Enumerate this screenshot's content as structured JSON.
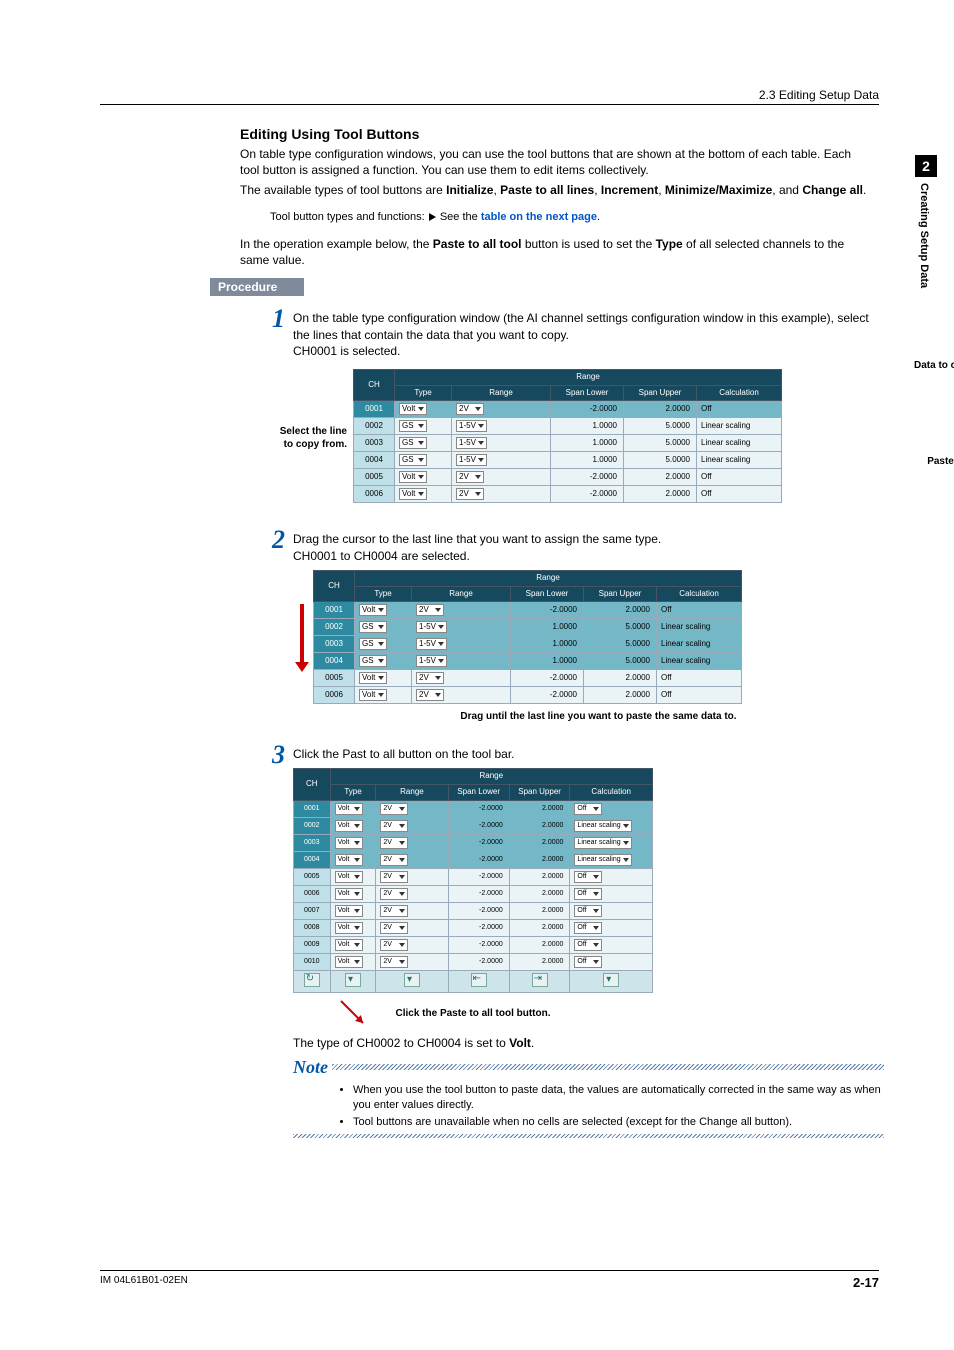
{
  "header": {
    "breadcrumb": "2.3  Editing Setup Data"
  },
  "side": {
    "chapter": "2",
    "chapter_title": "Creating Setup Data"
  },
  "title": "Editing Using Tool Buttons",
  "p1a": "On table type configuration windows, you can use the tool buttons that are shown at the bottom of each table. Each tool button is assigned a function. You can use them to edit items collectively.",
  "p1b_pre": "The available types of tool buttons are ",
  "p1b_b1": "Initialize",
  "p1b_mid1": ", ",
  "p1b_b2": "Paste to all lines",
  "p1b_mid2": ", ",
  "p1b_b3": "Increment",
  "p1b_mid3": ", ",
  "p1b_b4": "Minimize/Maximize",
  "p1b_mid4": ", and ",
  "p1b_b5": "Change all",
  "p1b_end": ".",
  "p1c_pre": "Tool button types and functions: ",
  "p1c_link_pre": "See the ",
  "p1c_link": "table on the next page",
  "p2_pre": "In the operation example below, the ",
  "p2_b1": "Paste to all tool",
  "p2_mid": " button is used to set the ",
  "p2_b2": "Type",
  "p2_end": " of all selected channels to the same value.",
  "procedure_label": "Procedure",
  "steps": {
    "1": {
      "num": "1",
      "text_a": "On the table type configuration window (the AI channel settings configuration window in this example), select the lines that contain the data that you want to copy.",
      "text_b": "CH0001 is selected."
    },
    "2": {
      "num": "2",
      "text_a": "Drag the cursor to the last line that you want to assign the same type.",
      "text_b": "CH0001 to CH0004 are selected."
    },
    "3": {
      "num": "3",
      "text_pre": "Click the ",
      "text_b": "Past to all",
      "text_post": " button on the tool bar."
    }
  },
  "callouts": {
    "data_to_copy": "Data to copy",
    "select_line_a": "Select the line",
    "select_line_b": "to copy from.",
    "paste_dest": "Paste destination",
    "drag_caption": "Drag until the last line you want to paste the same data to.",
    "click_caption": "Click the Paste to all tool button."
  },
  "headers": {
    "ch": "CH",
    "range_group": "Range",
    "type": "Type",
    "range": "Range",
    "span_lower": "Span Lower",
    "span_upper": "Span Upper",
    "calculation": "Calculation"
  },
  "table1": [
    {
      "ch": "0001",
      "type": "Volt",
      "range": "2V",
      "lo": "-2.0000",
      "up": "2.0000",
      "calc": "Off",
      "sel": true
    },
    {
      "ch": "0002",
      "type": "GS",
      "range": "1-5V",
      "lo": "1.0000",
      "up": "5.0000",
      "calc": "Linear scaling",
      "sel": false
    },
    {
      "ch": "0003",
      "type": "GS",
      "range": "1-5V",
      "lo": "1.0000",
      "up": "5.0000",
      "calc": "Linear scaling",
      "sel": false
    },
    {
      "ch": "0004",
      "type": "GS",
      "range": "1-5V",
      "lo": "1.0000",
      "up": "5.0000",
      "calc": "Linear scaling",
      "sel": false
    },
    {
      "ch": "0005",
      "type": "Volt",
      "range": "2V",
      "lo": "-2.0000",
      "up": "2.0000",
      "calc": "Off",
      "sel": false
    },
    {
      "ch": "0006",
      "type": "Volt",
      "range": "2V",
      "lo": "-2.0000",
      "up": "2.0000",
      "calc": "Off",
      "sel": false
    }
  ],
  "table2": [
    {
      "ch": "0001",
      "type": "Volt",
      "range": "2V",
      "lo": "-2.0000",
      "up": "2.0000",
      "calc": "Off",
      "sel": true
    },
    {
      "ch": "0002",
      "type": "GS",
      "range": "1-5V",
      "lo": "1.0000",
      "up": "5.0000",
      "calc": "Linear scaling",
      "sel": true
    },
    {
      "ch": "0003",
      "type": "GS",
      "range": "1-5V",
      "lo": "1.0000",
      "up": "5.0000",
      "calc": "Linear scaling",
      "sel": true
    },
    {
      "ch": "0004",
      "type": "GS",
      "range": "1-5V",
      "lo": "1.0000",
      "up": "5.0000",
      "calc": "Linear scaling",
      "sel": true
    },
    {
      "ch": "0005",
      "type": "Volt",
      "range": "2V",
      "lo": "-2.0000",
      "up": "2.0000",
      "calc": "Off",
      "sel": false
    },
    {
      "ch": "0006",
      "type": "Volt",
      "range": "2V",
      "lo": "-2.0000",
      "up": "2.0000",
      "calc": "Off",
      "sel": false
    }
  ],
  "table3": [
    {
      "ch": "0001",
      "type": "Volt",
      "range": "2V",
      "lo": "-2.0000",
      "up": "2.0000",
      "calc": "Off",
      "sel": true
    },
    {
      "ch": "0002",
      "type": "Volt",
      "range": "2V",
      "lo": "-2.0000",
      "up": "2.0000",
      "calc": "Linear scaling",
      "sel": true
    },
    {
      "ch": "0003",
      "type": "Volt",
      "range": "2V",
      "lo": "-2.0000",
      "up": "2.0000",
      "calc": "Linear scaling",
      "sel": true
    },
    {
      "ch": "0004",
      "type": "Volt",
      "range": "2V",
      "lo": "-2.0000",
      "up": "2.0000",
      "calc": "Linear scaling",
      "sel": true
    },
    {
      "ch": "0005",
      "type": "Volt",
      "range": "2V",
      "lo": "-2.0000",
      "up": "2.0000",
      "calc": "Off",
      "sel": false
    },
    {
      "ch": "0006",
      "type": "Volt",
      "range": "2V",
      "lo": "-2.0000",
      "up": "2.0000",
      "calc": "Off",
      "sel": false
    },
    {
      "ch": "0007",
      "type": "Volt",
      "range": "2V",
      "lo": "-2.0000",
      "up": "2.0000",
      "calc": "Off",
      "sel": false
    },
    {
      "ch": "0008",
      "type": "Volt",
      "range": "2V",
      "lo": "-2.0000",
      "up": "2.0000",
      "calc": "Off",
      "sel": false
    },
    {
      "ch": "0009",
      "type": "Volt",
      "range": "2V",
      "lo": "-2.0000",
      "up": "2.0000",
      "calc": "Off",
      "sel": false
    },
    {
      "ch": "0010",
      "type": "Volt",
      "range": "2V",
      "lo": "-2.0000",
      "up": "2.0000",
      "calc": "Off",
      "sel": false
    }
  ],
  "result_pre": "The type of CH0002 to CH0004 is set to ",
  "result_b": "Volt",
  "result_end": ".",
  "note_label": "Note",
  "notes": {
    "n1": "When you use the tool button to paste data, the values are automatically corrected in the same way as when you enter values directly.",
    "n2_pre": "Tool buttons are unavailable when no cells are selected (except for the ",
    "n2_b": "Change all",
    "n2_post": " button)."
  },
  "footer": {
    "doc": "IM 04L61B01-02EN",
    "page": "2-17"
  }
}
